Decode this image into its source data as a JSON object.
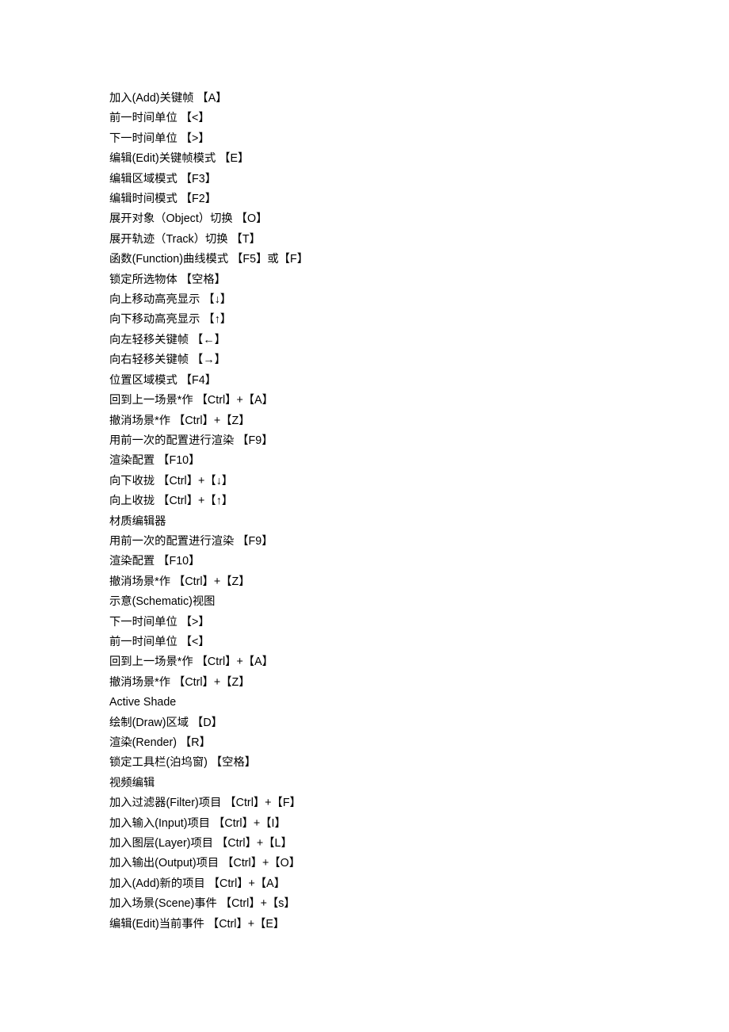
{
  "document": {
    "page_background": "#ffffff",
    "text_color": "#000000",
    "lines": [
      {
        "id": "add-keyframe",
        "text": "加入(Add)关键帧 【A】"
      },
      {
        "id": "prev-time-unit",
        "text": "前一时间单位 【<】"
      },
      {
        "id": "next-time-unit",
        "text": "下一时间单位 【>】"
      },
      {
        "id": "edit-keyframe-mode",
        "text": "编辑(Edit)关键帧模式 【E】"
      },
      {
        "id": "edit-region-mode",
        "text": "编辑区域模式 【F3】"
      },
      {
        "id": "edit-time-mode",
        "text": "编辑时间模式 【F2】"
      },
      {
        "id": "expand-object-toggle",
        "text": "展开对象（Object）切换 【O】"
      },
      {
        "id": "expand-track-toggle",
        "text": "展开轨迹（Track）切换 【T】"
      },
      {
        "id": "function-curve-mode",
        "text": "函数(Function)曲线模式 【F5】或【F】"
      },
      {
        "id": "lock-selected-object",
        "text": "锁定所选物体 【空格】"
      },
      {
        "id": "move-highlight-up",
        "text": "向上移动高亮显示 【↓】"
      },
      {
        "id": "move-highlight-down",
        "text": "向下移动高亮显示 【↑】"
      },
      {
        "id": "nudge-keyframe-left",
        "text": "向左轻移关键帧 【←】"
      },
      {
        "id": "nudge-keyframe-right",
        "text": "向右轻移关键帧 【→】"
      },
      {
        "id": "position-region-mode",
        "text": "位置区域模式 【F4】"
      },
      {
        "id": "redo-scene-op-1",
        "text": "回到上一场景*作 【Ctrl】+【A】"
      },
      {
        "id": "undo-scene-op-1",
        "text": "撤消场景*作 【Ctrl】+【Z】"
      },
      {
        "id": "render-prev-config-1",
        "text": "用前一次的配置进行渲染 【F9】"
      },
      {
        "id": "render-config-1",
        "text": "渲染配置 【F10】"
      },
      {
        "id": "collapse-down",
        "text": "向下收拢 【Ctrl】+【↓】"
      },
      {
        "id": "collapse-up",
        "text": "向上收拢 【Ctrl】+【↑】"
      },
      {
        "id": "section-material-editor",
        "text": "材质编辑器"
      },
      {
        "id": "render-prev-config-2",
        "text": "用前一次的配置进行渲染 【F9】"
      },
      {
        "id": "render-config-2",
        "text": "渲染配置 【F10】"
      },
      {
        "id": "undo-scene-op-2",
        "text": "撤消场景*作 【Ctrl】+【Z】"
      },
      {
        "id": "section-schematic-view",
        "text": "示意(Schematic)视图"
      },
      {
        "id": "next-time-unit-2",
        "text": "下一时间单位 【>】"
      },
      {
        "id": "prev-time-unit-2",
        "text": "前一时间单位 【<】"
      },
      {
        "id": "redo-scene-op-2",
        "text": "回到上一场景*作 【Ctrl】+【A】"
      },
      {
        "id": "undo-scene-op-3",
        "text": "撤消场景*作 【Ctrl】+【Z】"
      },
      {
        "id": "section-active-shade",
        "text": "Active Shade"
      },
      {
        "id": "draw-region",
        "text": "绘制(Draw)区域 【D】"
      },
      {
        "id": "render",
        "text": "渲染(Render) 【R】"
      },
      {
        "id": "lock-toolbar-docker",
        "text": "锁定工具栏(泊坞窗) 【空格】"
      },
      {
        "id": "section-video-edit",
        "text": "视频编辑"
      },
      {
        "id": "add-filter-item",
        "text": "加入过滤器(Filter)项目 【Ctrl】+【F】"
      },
      {
        "id": "add-input-item",
        "text": "加入输入(Input)项目 【Ctrl】+【I】"
      },
      {
        "id": "add-layer-item",
        "text": "加入图层(Layer)项目 【Ctrl】+【L】"
      },
      {
        "id": "add-output-item",
        "text": "加入输出(Output)项目 【Ctrl】+【O】"
      },
      {
        "id": "add-new-item",
        "text": "加入(Add)新的项目 【Ctrl】+【A】"
      },
      {
        "id": "add-scene-event",
        "text": "加入场景(Scene)事件 【Ctrl】+【s】"
      },
      {
        "id": "edit-current-event",
        "text": "编辑(Edit)当前事件 【Ctrl】+【E】"
      }
    ]
  }
}
